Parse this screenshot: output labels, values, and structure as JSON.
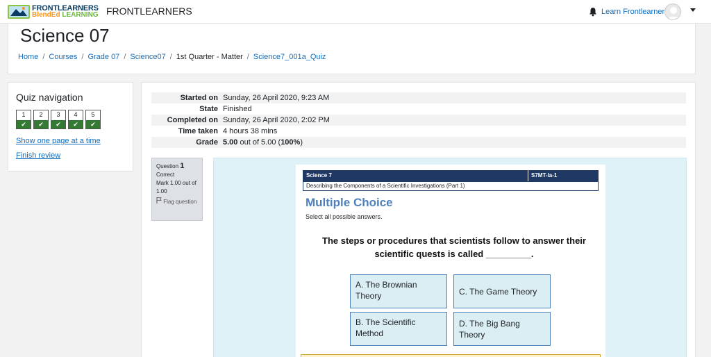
{
  "navbar": {
    "logo_line1": "FRONTLEARNERS",
    "logo_line2a": "BlendEd",
    "logo_line2b": " LEARNING",
    "site_name": "FRONTLEARNERS",
    "user_name": "Learn Frontlearners",
    "icons": {
      "notifications": "bell-icon",
      "user_menu": "chevron-down-icon"
    }
  },
  "header": {
    "title": "Science 07",
    "breadcrumb": [
      {
        "label": "Home",
        "link": true
      },
      {
        "label": "Courses",
        "link": true
      },
      {
        "label": "Grade 07",
        "link": true
      },
      {
        "label": "Science07",
        "link": true
      },
      {
        "label": "1st Quarter - Matter",
        "link": false
      },
      {
        "label": "Science7_001a_Quiz",
        "link": true
      }
    ]
  },
  "quiz_navigation": {
    "title": "Quiz navigation",
    "questions": [
      {
        "number": "1",
        "status": "correct"
      },
      {
        "number": "2",
        "status": "correct"
      },
      {
        "number": "3",
        "status": "correct"
      },
      {
        "number": "4",
        "status": "correct"
      },
      {
        "number": "5",
        "status": "correct"
      }
    ],
    "check_glyph": "✔",
    "show_one_page": "Show one page at a time",
    "finish_review": "Finish review"
  },
  "summary": {
    "rows": [
      {
        "key": "Started on",
        "value": "Sunday, 26 April 2020, 9:23 AM"
      },
      {
        "key": "State",
        "value": "Finished"
      },
      {
        "key": "Completed on",
        "value": "Sunday, 26 April 2020, 2:02 PM"
      },
      {
        "key": "Time taken",
        "value": "4 hours 38 mins"
      }
    ],
    "grade_key": "Grade",
    "grade_value": "5.00",
    "grade_mid": " out of 5.00 (",
    "grade_percent": "100%",
    "grade_end": ")"
  },
  "question_info": {
    "label": "Question",
    "number": "1",
    "state": "Correct",
    "mark": "Mark 1.00 out of 1.00",
    "flag": "Flag question"
  },
  "worksheet": {
    "subject": "Science 7",
    "code": "S7MT-Ia-1",
    "lesson": "Describing the Components of a Scientific Investigations (Part 1)",
    "section_title": "Multiple Choice",
    "instruction": "Select all possible answers.",
    "stem": "The steps or procedures that scientists follow to answer their scientific quests is called _________.",
    "options": [
      "A. The Brownian Theory",
      "C. The Game Theory",
      "B. The Scientific Method",
      "D. The Big Bang Theory"
    ]
  },
  "colors": {
    "link": "#0f6cbf",
    "correct": "#357a32",
    "question_bg": "#def2f8",
    "worksheet_header": "#1f3864",
    "mc_title": "#4f81bd"
  }
}
